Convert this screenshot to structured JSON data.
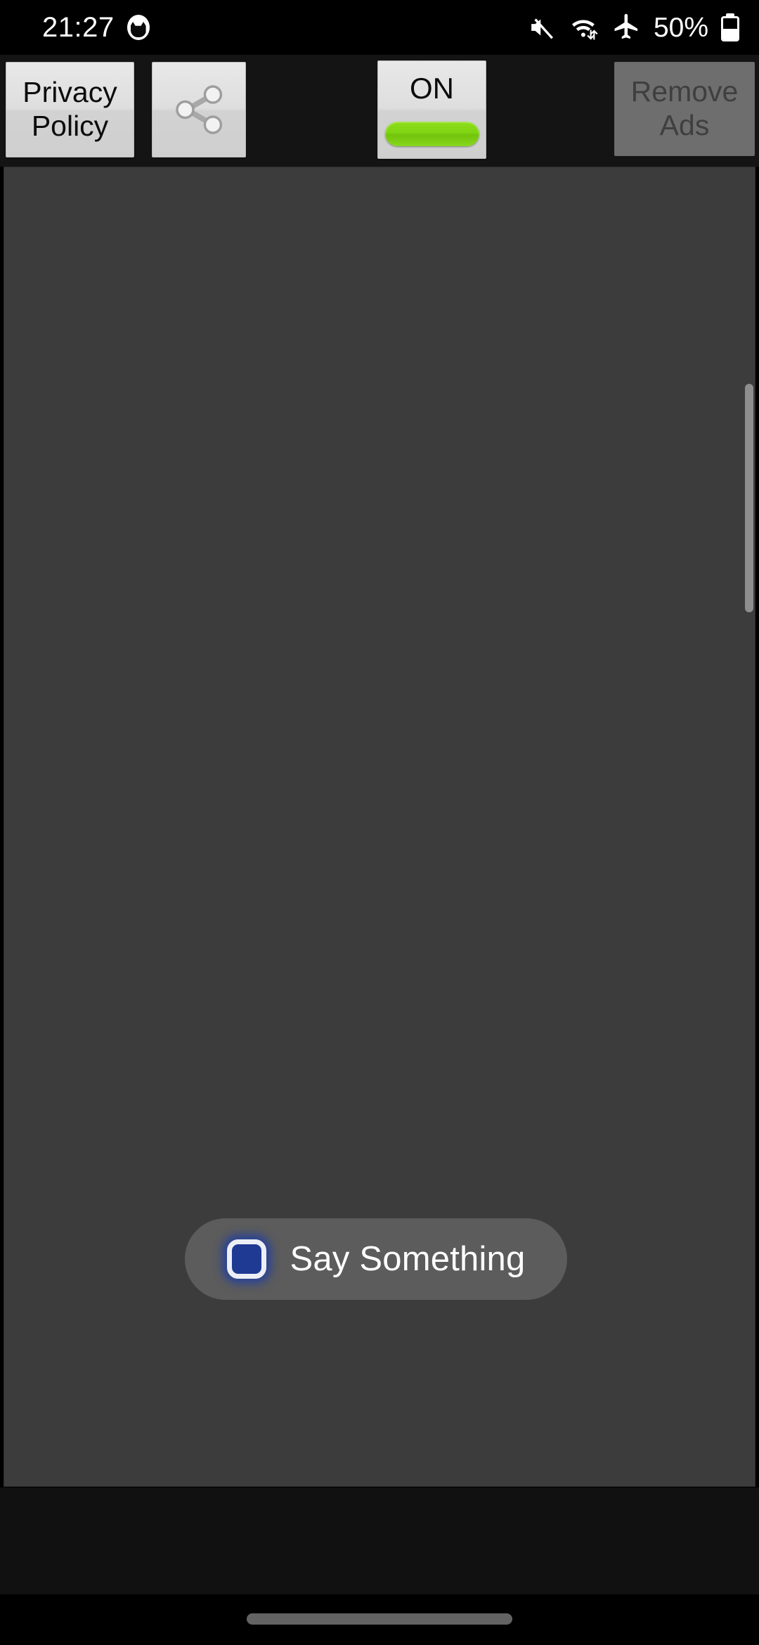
{
  "status_bar": {
    "time": "21:27",
    "notification_icon": "app-notification-icon",
    "icons": [
      {
        "name": "mute-icon",
        "label": "Sound muted"
      },
      {
        "name": "wifi-icon",
        "label": "Wi-Fi with data transfer"
      },
      {
        "name": "airplane-mode-icon",
        "label": "Airplane mode"
      }
    ],
    "battery_percent": "50%",
    "battery_level": 50
  },
  "toolbar": {
    "privacy_policy_label": "Privacy\nPolicy",
    "privacy_policy_line1": "Privacy",
    "privacy_policy_line2": "Policy",
    "share_icon": "share-icon",
    "toggle_label": "ON",
    "toggle_state": "on",
    "toggle_indicator_color": "#7fd413",
    "remove_ads_line1": "Remove",
    "remove_ads_line2": "Ads",
    "remove_ads_enabled": false
  },
  "content": {
    "background_color": "#3c3c3c",
    "body_text": "",
    "scrollbar_visible": true
  },
  "say_button": {
    "label": "Say Something",
    "icon": "stop-square-icon",
    "icon_color": "#1f3a93",
    "background_color": "#5c5c5c"
  },
  "navigation": {
    "handle": "gesture-navigation-handle"
  }
}
